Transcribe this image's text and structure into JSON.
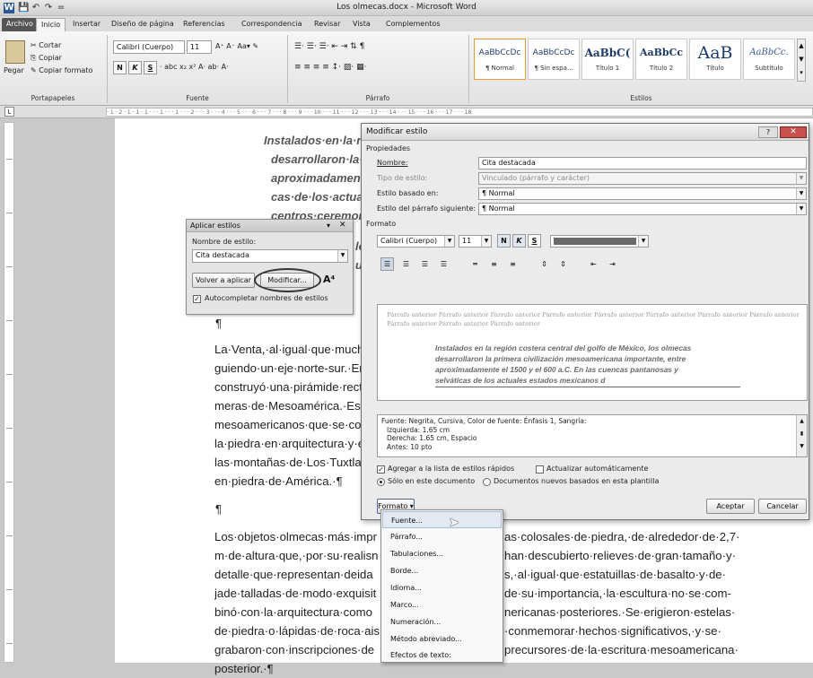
{
  "window": {
    "title": "Los olmecas.docx - Microsoft Word"
  },
  "qat": [
    "W",
    "💾",
    "↶",
    "↷",
    "="
  ],
  "tabs": [
    "Archivo",
    "Inicio",
    "Insertar",
    "Diseño de página",
    "Referencias",
    "Correspondencia",
    "Revisar",
    "Vista",
    "Complementos"
  ],
  "ribbon": {
    "clipboard": {
      "paste": "Pegar",
      "cut": "Cortar",
      "copy": "Copiar",
      "format_painter": "Copiar formato",
      "label": "Portapapeles"
    },
    "font": {
      "name": "Calibri (Cuerpo)",
      "size": "11",
      "label": "Fuente",
      "row1": "A⁺ A⁻  Aa▾  ✎",
      "row2_bold": "N",
      "row2_italic": "K",
      "row2_under": "S",
      "row2_rest": "· abc x₂ x²  A· ab· A·"
    },
    "paragraph": {
      "label": "Párrafo",
      "row1": "☰· ☰· ☰·  ⇤ ⇥  ⇅  ¶",
      "row2": "≡ ≡ ≡ ≡  ↕·  ▨·  ▦·"
    },
    "styles": {
      "label": "Estilos",
      "items": [
        {
          "preview": "AaBbCcDc",
          "name": "¶ Normal"
        },
        {
          "preview": "AaBbCcDc",
          "name": "¶ Sin espa..."
        },
        {
          "preview": "AaBbC(",
          "name": "Título 1"
        },
        {
          "preview": "AaBbCc",
          "name": "Título 2"
        },
        {
          "preview": "AaB",
          "name": "Título"
        },
        {
          "preview": "AaBbCc.",
          "name": "Subtítulo"
        }
      ]
    }
  },
  "ruler": "· 1 · 2 · 1 · 1 · 1 · · · 1 · · · 1 · · · 2 · · · 3 · · · 4 · · · 5 · · · 6 · · · 7 · · · 8 · · · 9 · · · 10 · · · 11 · · · 12 · · · 13 · · · 14 · · · 15 · · · 16 · · · 17 · · · 18",
  "document": {
    "quote": [
      "Instalados·en·la·r",
      "desarrollaron·la·p",
      "aproximadament",
      "cas·de·los·actuale",
      "centros·ceremon"
    ],
    "quote_hidden_1": "lo",
    "quote_hidden_2": "ue",
    "pilcrow": "¶",
    "para1": [
      "La·Venta,·al·igual·que·mucho",
      "guiendo·un·eje·norte-sur.·Er",
      "construyó·una·pirámide·rect",
      "meras·de·Mesoamérica.·Est",
      "mesoamericanos·que·se·con",
      "la·piedra·en·arquitectura·y·e",
      "las·montañas·de·Los·Tuxtlas",
      "en·piedra·de·América.·¶"
    ],
    "para2_left": [
      "Los·objetos·olmecas·más·impr",
      "m·de·altura·que,·por·su·realisn",
      "detalle·que·representan·deida",
      "jade·talladas·de·modo·exquisit",
      "binó·con·la·arquitectura·como",
      "de·piedra·o·lápidas·de·roca·ais",
      "grabaron·con·inscripciones·de",
      "posterior.·¶"
    ],
    "para2_right": [
      "as·colosales·de·piedra,·de·alrededor·de·2,7·",
      "han·descubierto·relieves·de·gran·tamaño·y·",
      "s,·al·igual·que·estatuillas·de·basalto·y·de·",
      "de·su·importancia,·la·escultura·no·se·com-",
      "nericanas·posteriores.·Se·erigieron·estelas·",
      "·conmemorar·hechos·significativos,·y·se·",
      "precursores·de·la·escritura·mesoamericana·",
      ""
    ]
  },
  "apply_styles": {
    "title": "Aplicar estilos",
    "name_label": "Nombre de estilo:",
    "name_value": "Cita destacada",
    "reapply": "Volver a aplicar",
    "modify": "Modificar...",
    "autocomplete": "Autocompletar nombres de estilos"
  },
  "modify_style": {
    "title": "Modificar estilo",
    "properties": "Propiedades",
    "name_label": "Nombre:",
    "name_value": "Cita destacada",
    "type_label": "Tipo de estilo:",
    "type_value": "Vinculado (párrafo y carácter)",
    "based_label": "Estilo basado en:",
    "based_value": "¶ Normal",
    "next_label": "Estilo del párrafo siguiente:",
    "next_value": "¶ Normal",
    "format": "Formato",
    "font": "Calibri (Cuerpo)",
    "size": "11",
    "bold": "N",
    "italic": "K",
    "underline": "S",
    "preview_prev": "Párrafo anterior Párrafo anterior Párrafo anterior Párrafo anterior Párrafo anterior Párrafo anterior Párrafo anterior Párrafo anterior Párrafo anterior Párrafo anterior Párrafo anterior",
    "preview_lines": [
      "Instalados en la región costera central del golfo de México, los olmecas",
      "desarrollaron la primera civilización mesoamericana importante, entre",
      "aproximadamente el 1500 y el 600 a.C. En las cuencas pantanosas y",
      "selváticas de los actuales estados mexicanos d"
    ],
    "desc_lines": [
      "Fuente: Negrita, Cursiva, Color de fuente: Énfasis 1, Sangría:",
      "Izquierda:  1.65 cm",
      "Derecha:  1.65 cm, Espacio",
      "Antes:  10 pto"
    ],
    "add_quick": "Agregar a la lista de estilos rápidos",
    "auto_update": "Actualizar automáticamente",
    "only_doc": "Sólo en este documento",
    "new_docs": "Documentos nuevos basados en esta plantilla",
    "format_btn": "Formato ▾",
    "ok": "Aceptar",
    "cancel": "Cancelar"
  },
  "format_menu": [
    "Fuente...",
    "Párrafo...",
    "Tabulaciones...",
    "Borde...",
    "Idioma...",
    "Marco...",
    "Numeración...",
    "Método abreviado...",
    "Efectos de texto:"
  ]
}
